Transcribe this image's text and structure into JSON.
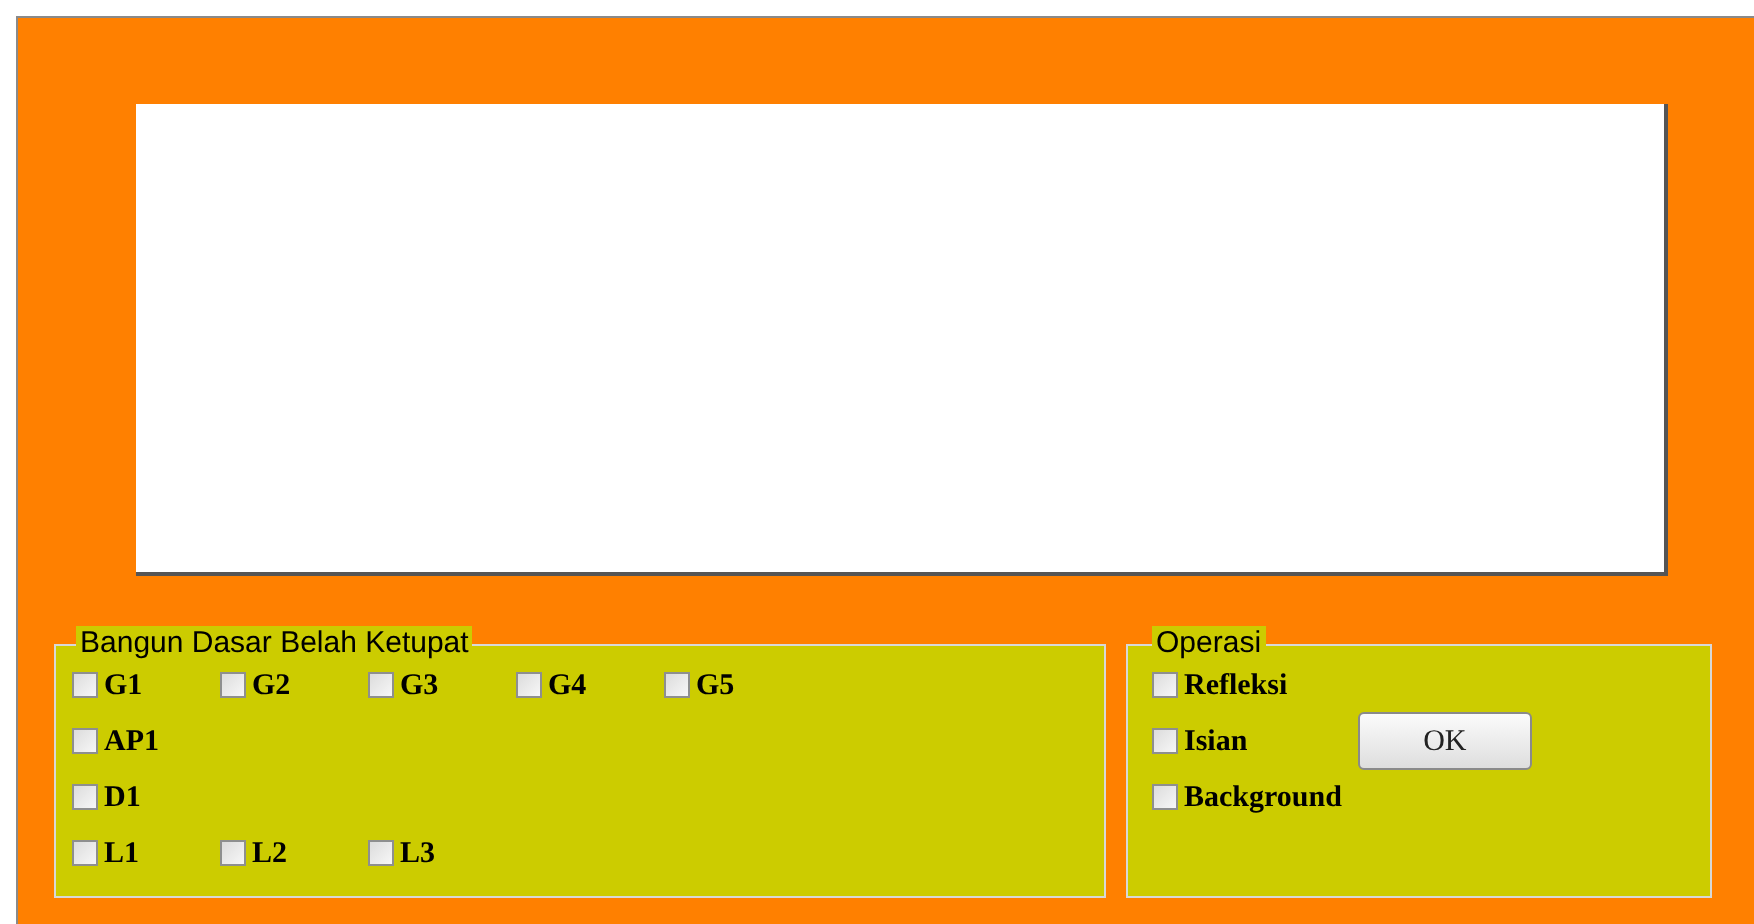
{
  "shape_panel": {
    "legend": "Bangun Dasar Belah Ketupat",
    "rows": [
      [
        {
          "label": "G1",
          "checked": false
        },
        {
          "label": "G2",
          "checked": false
        },
        {
          "label": "G3",
          "checked": false
        },
        {
          "label": "G4",
          "checked": false
        },
        {
          "label": "G5",
          "checked": false
        }
      ],
      [
        {
          "label": "AP1",
          "checked": false
        }
      ],
      [
        {
          "label": "D1",
          "checked": false
        }
      ],
      [
        {
          "label": "L1",
          "checked": false
        },
        {
          "label": "L2",
          "checked": false
        },
        {
          "label": "L3",
          "checked": false
        }
      ]
    ]
  },
  "operation_panel": {
    "legend": "Operasi",
    "options": [
      {
        "label": "Refleksi",
        "checked": false
      },
      {
        "label": "Isian",
        "checked": false
      },
      {
        "label": "Background",
        "checked": false
      }
    ],
    "button": "OK"
  }
}
